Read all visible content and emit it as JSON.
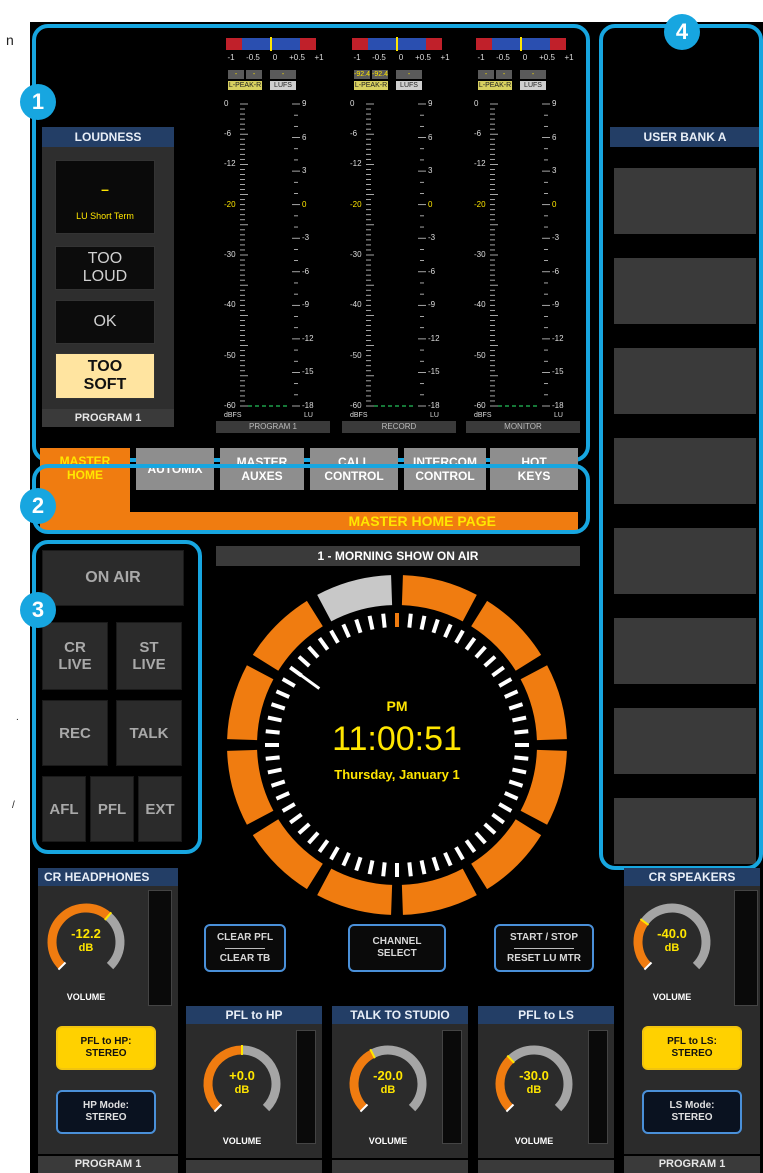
{
  "loudness": {
    "title": "LOUDNESS",
    "value": "–",
    "unit": "LU Short Term",
    "status_buttons": [
      {
        "label": "TOO\nLOUD"
      },
      {
        "label": "OK"
      },
      {
        "label": "TOO\nSOFT"
      }
    ],
    "footer": "PROGRAM 1"
  },
  "meters": [
    {
      "name": "PROGRAM 1",
      "scale": [
        "-1",
        "-0.5",
        "0",
        "+0.5",
        "+1"
      ],
      "readouts": [
        "-",
        "-",
        "-"
      ],
      "tags": [
        "L-PEAK-R",
        "LUFS"
      ],
      "dbfs_ticks": [
        "0",
        "-6",
        "-12",
        "-20",
        "-30",
        "-40",
        "-50",
        "-60"
      ],
      "lu_ticks": [
        "9",
        "6",
        "3",
        "0",
        "-3",
        "-6",
        "-9",
        "-12",
        "-15",
        "-18"
      ],
      "dbfs_unit": "dBFS",
      "lu_unit": "LU"
    },
    {
      "name": "RECORD",
      "scale": [
        "-1",
        "-0.5",
        "0",
        "+0.5",
        "+1"
      ],
      "readouts": [
        "-92.4",
        "-92.4",
        "-"
      ],
      "tags": [
        "L-PEAK-R",
        "LUFS"
      ],
      "dbfs_ticks": [
        "0",
        "-6",
        "-12",
        "-20",
        "-30",
        "-40",
        "-50",
        "-60"
      ],
      "lu_ticks": [
        "9",
        "6",
        "3",
        "0",
        "-3",
        "-6",
        "-9",
        "-12",
        "-15",
        "-18"
      ],
      "dbfs_unit": "dBFS",
      "lu_unit": "LU"
    },
    {
      "name": "MONITOR",
      "scale": [
        "-1",
        "-0.5",
        "0",
        "+0.5",
        "+1"
      ],
      "readouts": [
        "-",
        "-",
        "-"
      ],
      "tags": [
        "L-PEAK-R",
        "LUFS"
      ],
      "dbfs_ticks": [
        "0",
        "-6",
        "-12",
        "-20",
        "-30",
        "-40",
        "-50",
        "-60"
      ],
      "lu_ticks": [
        "9",
        "6",
        "3",
        "0",
        "-3",
        "-6",
        "-9",
        "-12",
        "-15",
        "-18"
      ],
      "dbfs_unit": "dBFS",
      "lu_unit": "LU"
    }
  ],
  "tabs": [
    {
      "label": "MASTER\nHOME",
      "active": true
    },
    {
      "label": "AUTOMIX",
      "active": false
    },
    {
      "label": "MASTER\nAUXES",
      "active": false
    },
    {
      "label": "CALL\nCONTROL",
      "active": false
    },
    {
      "label": "INTERCOM\nCONTROL",
      "active": false
    },
    {
      "label": "HOT\nKEYS",
      "active": false
    }
  ],
  "page_banner": "MASTER HOME PAGE",
  "status_buttons": {
    "on_air": "ON AIR",
    "cr_live": "CR\nLIVE",
    "st_live": "ST\nLIVE",
    "rec": "REC",
    "talk": "TALK",
    "afl": "AFL",
    "pfl": "PFL",
    "ext": "EXT"
  },
  "show_title": "1 - MORNING SHOW ON AIR",
  "clock": {
    "ampm": "PM",
    "time": "11:00:51",
    "date": "Thursday, January 1",
    "seconds": 51
  },
  "user_bank": {
    "title": "USER BANK A",
    "button_count": 8
  },
  "badges": [
    "1",
    "2",
    "3",
    "4"
  ],
  "cr_headphones": {
    "title": "CR HEADPHONES",
    "value": "-12.2",
    "unit": "dB",
    "label": "VOLUME",
    "level": 0.65,
    "pfl_button": "PFL to HP:\nSTEREO",
    "mode_button": "HP Mode:\nSTEREO",
    "footer": "PROGRAM 1"
  },
  "cr_speakers": {
    "title": "CR SPEAKERS",
    "value": "-40.0",
    "unit": "dB",
    "label": "VOLUME",
    "level": 0.3,
    "pfl_button": "PFL to LS:\nSTEREO",
    "mode_button": "LS Mode:\nSTEREO",
    "footer": "PROGRAM 1"
  },
  "center_buttons": {
    "clear_pfl": "CLEAR PFL",
    "clear_tb": "CLEAR TB",
    "channel_select": "CHANNEL\nSELECT",
    "start_stop": "START / STOP",
    "reset_lu": "RESET LU MTR"
  },
  "small_knobs": [
    {
      "title": "PFL to HP",
      "value": "+0.0",
      "unit": "dB",
      "label": "VOLUME",
      "level": 0.5
    },
    {
      "title": "TALK TO STUDIO",
      "value": "-20.0",
      "unit": "dB",
      "label": "VOLUME",
      "level": 0.4
    },
    {
      "title": "PFL to LS",
      "value": "-30.0",
      "unit": "dB",
      "label": "VOLUME",
      "level": 0.34
    }
  ],
  "colors": {
    "accent_blue": "#17a6e0",
    "orange": "#f07c10",
    "yellow": "#ffe600",
    "header_blue": "#233e66"
  }
}
